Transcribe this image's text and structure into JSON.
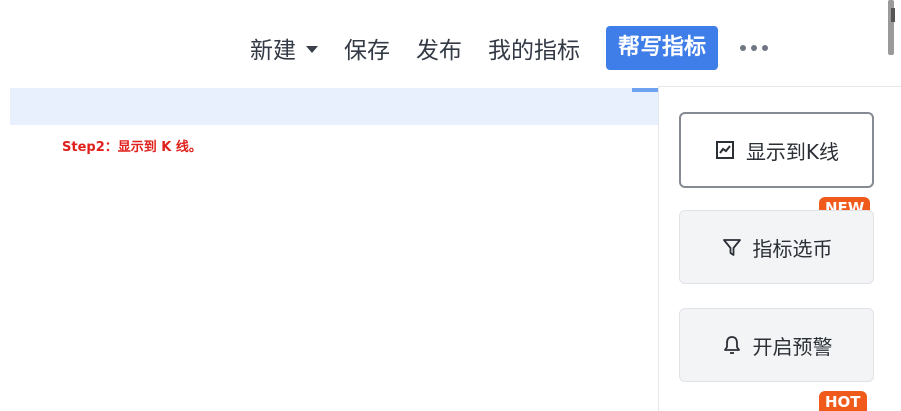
{
  "toolbar": {
    "new_label": "新建",
    "save_label": "保存",
    "publish_label": "发布",
    "my_indicators_label": "我的指标",
    "help_write_label": "帮写指标"
  },
  "annotation": {
    "step_text": "Step2：显示到 K 线。"
  },
  "side_panel": {
    "buttons": [
      {
        "label": "显示到K线",
        "icon": "chart-line-icon"
      },
      {
        "label": "指标选币",
        "icon": "filter-icon",
        "badge": "NEW"
      },
      {
        "label": "开启预警",
        "icon": "bell-icon",
        "badge": "HOT"
      }
    ]
  },
  "colors": {
    "primary": "#3f7de8",
    "badge": "#f05a1a",
    "annotation": "#e0201b",
    "band": "#e8f0fd"
  }
}
